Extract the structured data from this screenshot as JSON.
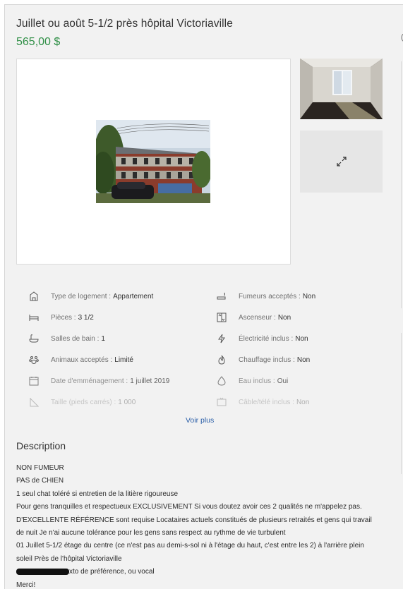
{
  "listing": {
    "title": "Juillet ou août 5-1/2 près hôpital Victoriaville",
    "price": "565,00 $"
  },
  "gallery": {
    "expand_icon": "expand-arrows-icon"
  },
  "features": [
    {
      "icon": "house-icon",
      "label": "Type de logement :",
      "value": "Appartement"
    },
    {
      "icon": "smoking-icon",
      "label": "Fumeurs acceptés :",
      "value": "Non"
    },
    {
      "icon": "bed-icon",
      "label": "Pièces :",
      "value": "3 1/2"
    },
    {
      "icon": "elevator-icon",
      "label": "Ascenseur :",
      "value": "Non"
    },
    {
      "icon": "bathtub-icon",
      "label": "Salles de bain :",
      "value": "1"
    },
    {
      "icon": "lightning-icon",
      "label": "Électricité inclus :",
      "value": "Non"
    },
    {
      "icon": "paw-icon",
      "label": "Animaux acceptés :",
      "value": "Limité"
    },
    {
      "icon": "flame-icon",
      "label": "Chauffage inclus :",
      "value": "Non"
    },
    {
      "icon": "calendar-icon",
      "label": "Date d'emménagement :",
      "value": "1 juillet 2019"
    },
    {
      "icon": "water-drop-icon",
      "label": "Eau inclus :",
      "value": "Oui"
    },
    {
      "icon": "ruler-icon",
      "label": "Taille (pieds carrés) :",
      "value": "1 000"
    },
    {
      "icon": "tv-icon",
      "label": "Câble/télé inclus :",
      "value": "Non"
    }
  ],
  "voir_plus": "Voir plus",
  "description": {
    "title": "Description",
    "lines": [
      "NON FUMEUR",
      "PAS de CHIEN",
      "1 seul chat toléré si entretien de la litière rigoureuse",
      "Pour gens tranquilles et respectueux EXCLUSIVEMENT Si vous doutez avoir ces 2 qualités ne m'appelez pas.",
      "D'EXCELLENTE RÉFÉRENCE sont requise Locataires actuels constitués de plusieurs retraités et gens qui travail",
      "de nuit Je n'ai aucune tolérance pour les gens sans respect au rythme de vie turbulent",
      "01 Juillet 5-1/2 étage du centre (ce n'est pas au demi-s-sol ni à l'étage du haut, c'est entre les 2) à l'arrière plein",
      "soleil Près de l'hôpital Victoriaville"
    ],
    "redacted_line_suffix": "xto de préférence, ou vocal",
    "closing": "Merci!"
  }
}
